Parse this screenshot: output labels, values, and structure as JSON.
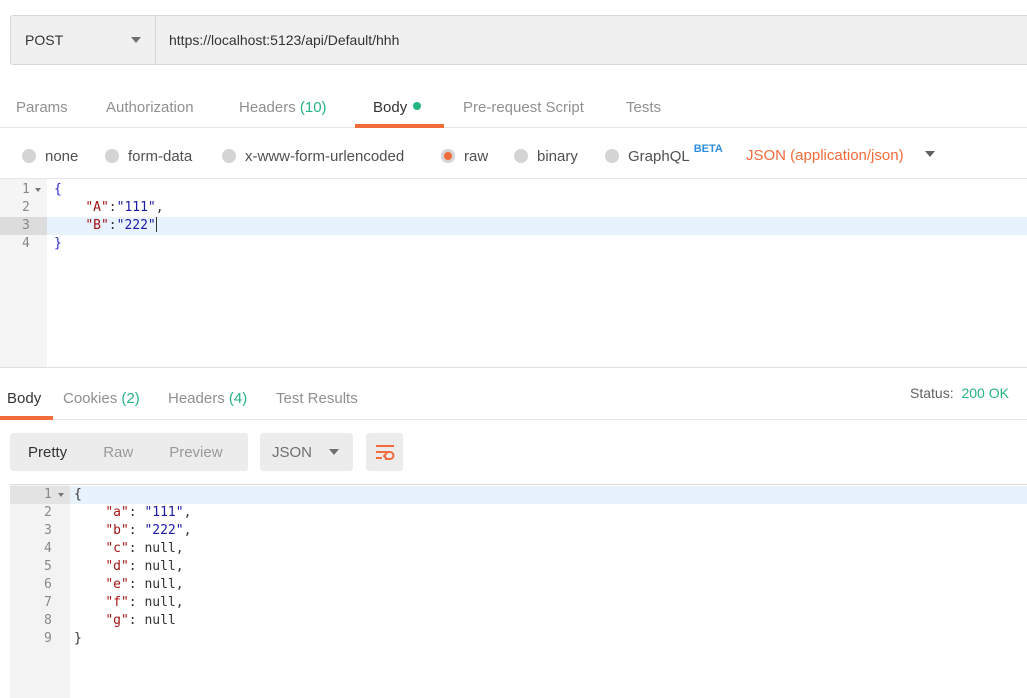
{
  "request": {
    "method": "POST",
    "url": "https://localhost:5123/api/Default/hhh"
  },
  "request_tabs": [
    {
      "label": "Params",
      "count": ""
    },
    {
      "label": "Authorization",
      "count": ""
    },
    {
      "label": "Headers",
      "count": "(10)"
    },
    {
      "label": "Body",
      "count": ""
    },
    {
      "label": "Pre-request Script",
      "count": ""
    },
    {
      "label": "Tests",
      "count": ""
    }
  ],
  "body_types": [
    {
      "label": "none",
      "checked": false
    },
    {
      "label": "form-data",
      "checked": false
    },
    {
      "label": "x-www-form-urlencoded",
      "checked": false
    },
    {
      "label": "raw",
      "checked": true
    },
    {
      "label": "binary",
      "checked": false
    },
    {
      "label": "GraphQL",
      "checked": false
    }
  ],
  "graphql_badge": "BETA",
  "content_type": "JSON (application/json)",
  "request_body": {
    "line_numbers": [
      "1",
      "2",
      "3",
      "4"
    ],
    "lines": [
      "{",
      "    \"A\":\"111\",",
      "    \"B\":\"222\"",
      "}"
    ],
    "A_key": "\"A\"",
    "A_value": "\"111\"",
    "B_key": "\"B\"",
    "B_value": "\"222\""
  },
  "response_tabs": [
    {
      "label": "Body",
      "count": ""
    },
    {
      "label": "Cookies",
      "count": "(2)"
    },
    {
      "label": "Headers",
      "count": "(4)"
    },
    {
      "label": "Test Results",
      "count": ""
    }
  ],
  "status": {
    "label": "Status:",
    "value": "200 OK"
  },
  "response_views": [
    "Pretty",
    "Raw",
    "Preview"
  ],
  "response_format": "JSON",
  "wrap_icon": "wrap-lines-icon",
  "response_body": {
    "line_numbers": [
      "1",
      "2",
      "3",
      "4",
      "5",
      "6",
      "7",
      "8",
      "9"
    ],
    "open": "{",
    "close": "}",
    "fields": [
      {
        "key": "\"a\"",
        "value": "\"111\"",
        "sep": ","
      },
      {
        "key": "\"b\"",
        "value": "\"222\"",
        "sep": ","
      },
      {
        "key": "\"c\"",
        "value": "null",
        "sep": ","
      },
      {
        "key": "\"d\"",
        "value": "null",
        "sep": ","
      },
      {
        "key": "\"e\"",
        "value": "null",
        "sep": ","
      },
      {
        "key": "\"f\"",
        "value": "null",
        "sep": ","
      },
      {
        "key": "\"g\"",
        "value": "null",
        "sep": ""
      }
    ]
  },
  "colors": {
    "accent": "#f26b3a",
    "success": "#26b47f",
    "beta": "#2f8ede"
  }
}
